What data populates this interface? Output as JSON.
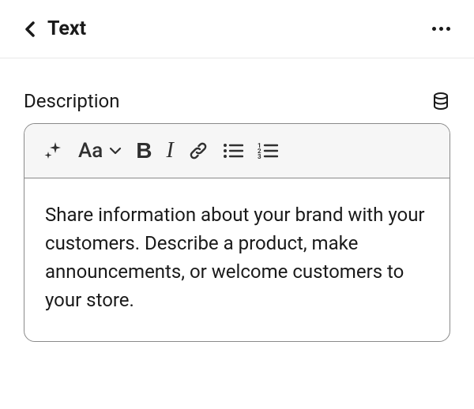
{
  "header": {
    "title": "Text"
  },
  "field": {
    "label": "Description"
  },
  "toolbar": {
    "fontSelectorLabel": "Aa"
  },
  "editor": {
    "content": "Share information about your brand with your customers. Describe a product, make announcements, or welcome customers to your store."
  }
}
